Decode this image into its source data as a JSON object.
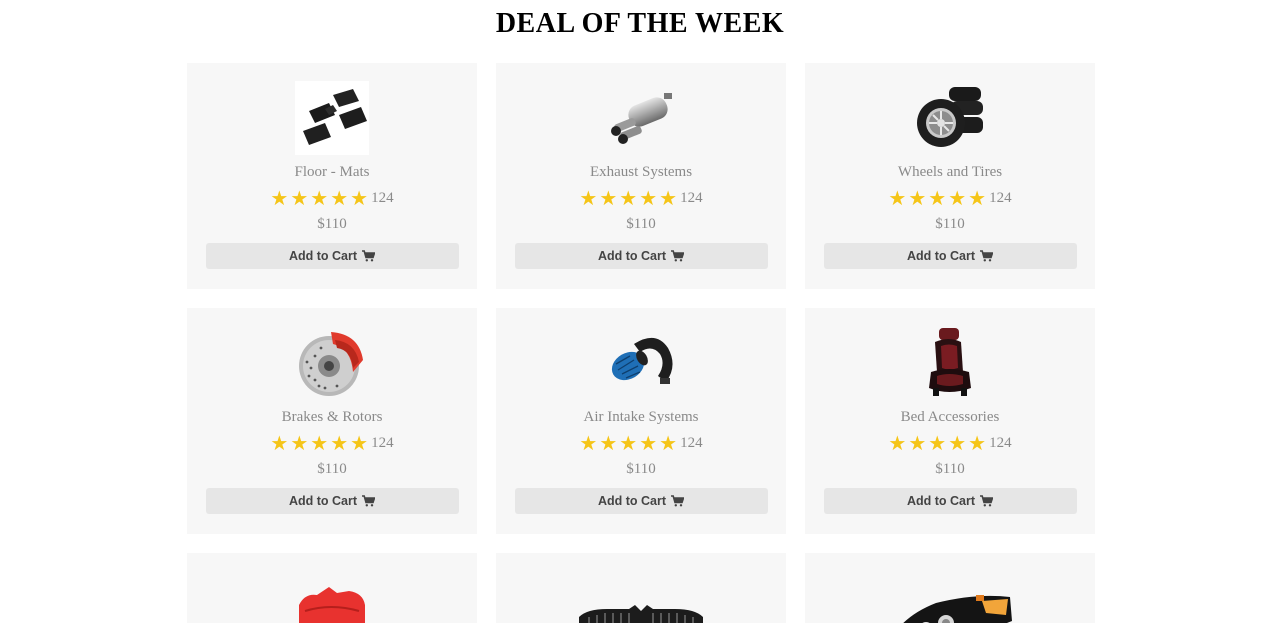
{
  "page": {
    "title": "DEAL OF THE WEEK"
  },
  "products": [
    {
      "name": "Floor - Mats",
      "rating_count": "124",
      "price": "$110",
      "button_label": "Add to Cart",
      "stars": 5,
      "icon": "floor-mats-image"
    },
    {
      "name": "Exhaust Systems",
      "rating_count": "124",
      "price": "$110",
      "button_label": "Add to Cart",
      "stars": 5,
      "icon": "exhaust-image"
    },
    {
      "name": "Wheels and Tires",
      "rating_count": "124",
      "price": "$110",
      "button_label": "Add to Cart",
      "stars": 5,
      "icon": "tires-image"
    },
    {
      "name": "Brakes & Rotors",
      "rating_count": "124",
      "price": "$110",
      "button_label": "Add to Cart",
      "stars": 5,
      "icon": "brake-rotor-image"
    },
    {
      "name": "Air Intake Systems",
      "rating_count": "124",
      "price": "$110",
      "button_label": "Add to Cart",
      "stars": 5,
      "icon": "air-intake-image"
    },
    {
      "name": "Bed Accessories",
      "rating_count": "124",
      "price": "$110",
      "button_label": "Add to Cart",
      "stars": 5,
      "icon": "car-seat-image"
    }
  ],
  "partial_products": [
    {
      "icon": "red-bumper-image"
    },
    {
      "icon": "grille-image"
    },
    {
      "icon": "headlight-image"
    }
  ],
  "colors": {
    "star": "#f5c518",
    "card_bg": "#f7f7f7",
    "button_bg": "#e6e6e6",
    "muted_text": "#8a8a8a"
  }
}
